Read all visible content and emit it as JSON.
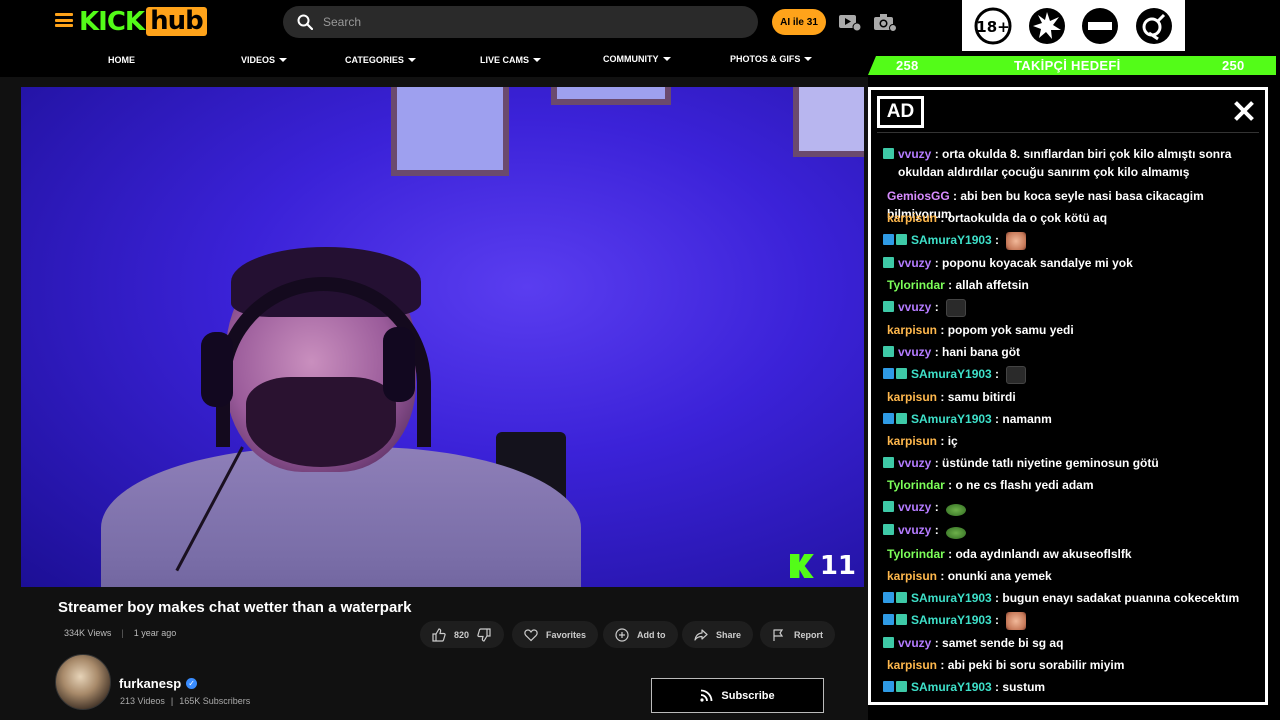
{
  "header": {
    "logo_kick": "KICK",
    "logo_hub": "hub",
    "search_placeholder": "Search",
    "ai_button": "AI ile 31"
  },
  "ratings_icons": [
    "18-plus-icon",
    "explosion-icon",
    "no-entry-icon",
    "gender-icon"
  ],
  "nav": [
    {
      "label": "HOME",
      "dropdown": false
    },
    {
      "label": "VIDEOS",
      "dropdown": true
    },
    {
      "label": "CATEGORIES",
      "dropdown": true
    },
    {
      "label": "LIVE CAMS",
      "dropdown": true
    },
    {
      "label": "COMMUNITY",
      "dropdown": true
    },
    {
      "label": "PHOTOS & GIFS",
      "dropdown": true
    }
  ],
  "video": {
    "overlay_number": "11",
    "title": "Streamer boy makes chat wetter than a waterpark",
    "views": "334K Views",
    "age": "1 year ago",
    "likes": "820",
    "favorites_label": "Favorites",
    "add_label": "Add to",
    "share_label": "Share",
    "report_label": "Report"
  },
  "channel": {
    "name": "furkanesp",
    "videos": "213 Videos",
    "subscribers": "165K Subscribers",
    "subscribe_label": "Subscribe"
  },
  "goal": {
    "current": "258",
    "label": "TAKİPÇİ HEDEFİ",
    "target": "250"
  },
  "chat": {
    "ad_label": "AD",
    "messages": [
      {
        "user": "vvuzy",
        "color": "#b47bff",
        "badges": [
          "green"
        ],
        "text": "orta okulda 8. sınıflardan biri çok kilo almıştı sonra okuldan aldırdılar çocuğu sanırım çok kilo almamış",
        "emote": ""
      },
      {
        "user": "GemiosGG",
        "color": "#d88cff",
        "badges": [],
        "text": "abi ben bu koca seyle nasi basa cikacagim bilmiyorum",
        "emote": ""
      },
      {
        "user": "karpisun",
        "color": "#ffb84d",
        "badges": [],
        "text": "ortaokulda da o çok kötü aq",
        "emote": ""
      },
      {
        "user": "SAmuraY1903",
        "color": "#3ee0c9",
        "badges": [
          "blue",
          "green"
        ],
        "text": "",
        "emote": "face"
      },
      {
        "user": "vvuzy",
        "color": "#b47bff",
        "badges": [
          "green"
        ],
        "text": "poponu koyacak sandalye mi yok",
        "emote": ""
      },
      {
        "user": "Tylorindar",
        "color": "#7dff5a",
        "badges": [],
        "text": "allah affetsin",
        "emote": ""
      },
      {
        "user": "vvuzy",
        "color": "#b47bff",
        "badges": [
          "green"
        ],
        "text": "",
        "emote": "dark"
      },
      {
        "user": "karpisun",
        "color": "#ffb84d",
        "badges": [],
        "text": "popom yok samu yedi",
        "emote": ""
      },
      {
        "user": "vvuzy",
        "color": "#b47bff",
        "badges": [
          "green"
        ],
        "text": "hani bana göt",
        "emote": ""
      },
      {
        "user": "SAmuraY1903",
        "color": "#3ee0c9",
        "badges": [
          "blue",
          "green"
        ],
        "text": "",
        "emote": "dark"
      },
      {
        "user": "karpisun",
        "color": "#ffb84d",
        "badges": [],
        "text": "samu bitirdi",
        "emote": ""
      },
      {
        "user": "SAmuraY1903",
        "color": "#3ee0c9",
        "badges": [
          "blue",
          "green"
        ],
        "text": "namanm",
        "emote": ""
      },
      {
        "user": "karpisun",
        "color": "#ffb84d",
        "badges": [],
        "text": "iç",
        "emote": ""
      },
      {
        "user": "vvuzy",
        "color": "#b47bff",
        "badges": [
          "green"
        ],
        "text": "üstünde tatlı niyetine geminosun götü",
        "emote": ""
      },
      {
        "user": "Tylorindar",
        "color": "#7dff5a",
        "badges": [],
        "text": "o ne cs flashı yedi adam",
        "emote": ""
      },
      {
        "user": "vvuzy",
        "color": "#b47bff",
        "badges": [
          "green"
        ],
        "text": "",
        "emote": "frog"
      },
      {
        "user": "vvuzy",
        "color": "#b47bff",
        "badges": [
          "green"
        ],
        "text": "",
        "emote": "frog"
      },
      {
        "user": "Tylorindar",
        "color": "#7dff5a",
        "badges": [],
        "text": "oda aydınlandı aw akuseoflslfk",
        "emote": ""
      },
      {
        "user": "karpisun",
        "color": "#ffb84d",
        "badges": [],
        "text": "onunki ana yemek",
        "emote": ""
      },
      {
        "user": "SAmuraY1903",
        "color": "#3ee0c9",
        "badges": [
          "blue",
          "green"
        ],
        "text": "bugun enayı sadakat puanına cokecektım",
        "emote": ""
      },
      {
        "user": "SAmuraY1903",
        "color": "#3ee0c9",
        "badges": [
          "blue",
          "green"
        ],
        "text": "",
        "emote": "face"
      },
      {
        "user": "vvuzy",
        "color": "#b47bff",
        "badges": [
          "green"
        ],
        "text": "samet sende bi sg aq",
        "emote": ""
      },
      {
        "user": "karpisun",
        "color": "#ffb84d",
        "badges": [],
        "text": "abi peki bi soru sorabilir miyim",
        "emote": ""
      },
      {
        "user": "SAmuraY1903",
        "color": "#3ee0c9",
        "badges": [
          "blue",
          "green"
        ],
        "text": "sustum",
        "emote": ""
      }
    ]
  },
  "colors": {
    "brand_orange": "#ffa31a",
    "kick_green": "#53fc18"
  }
}
